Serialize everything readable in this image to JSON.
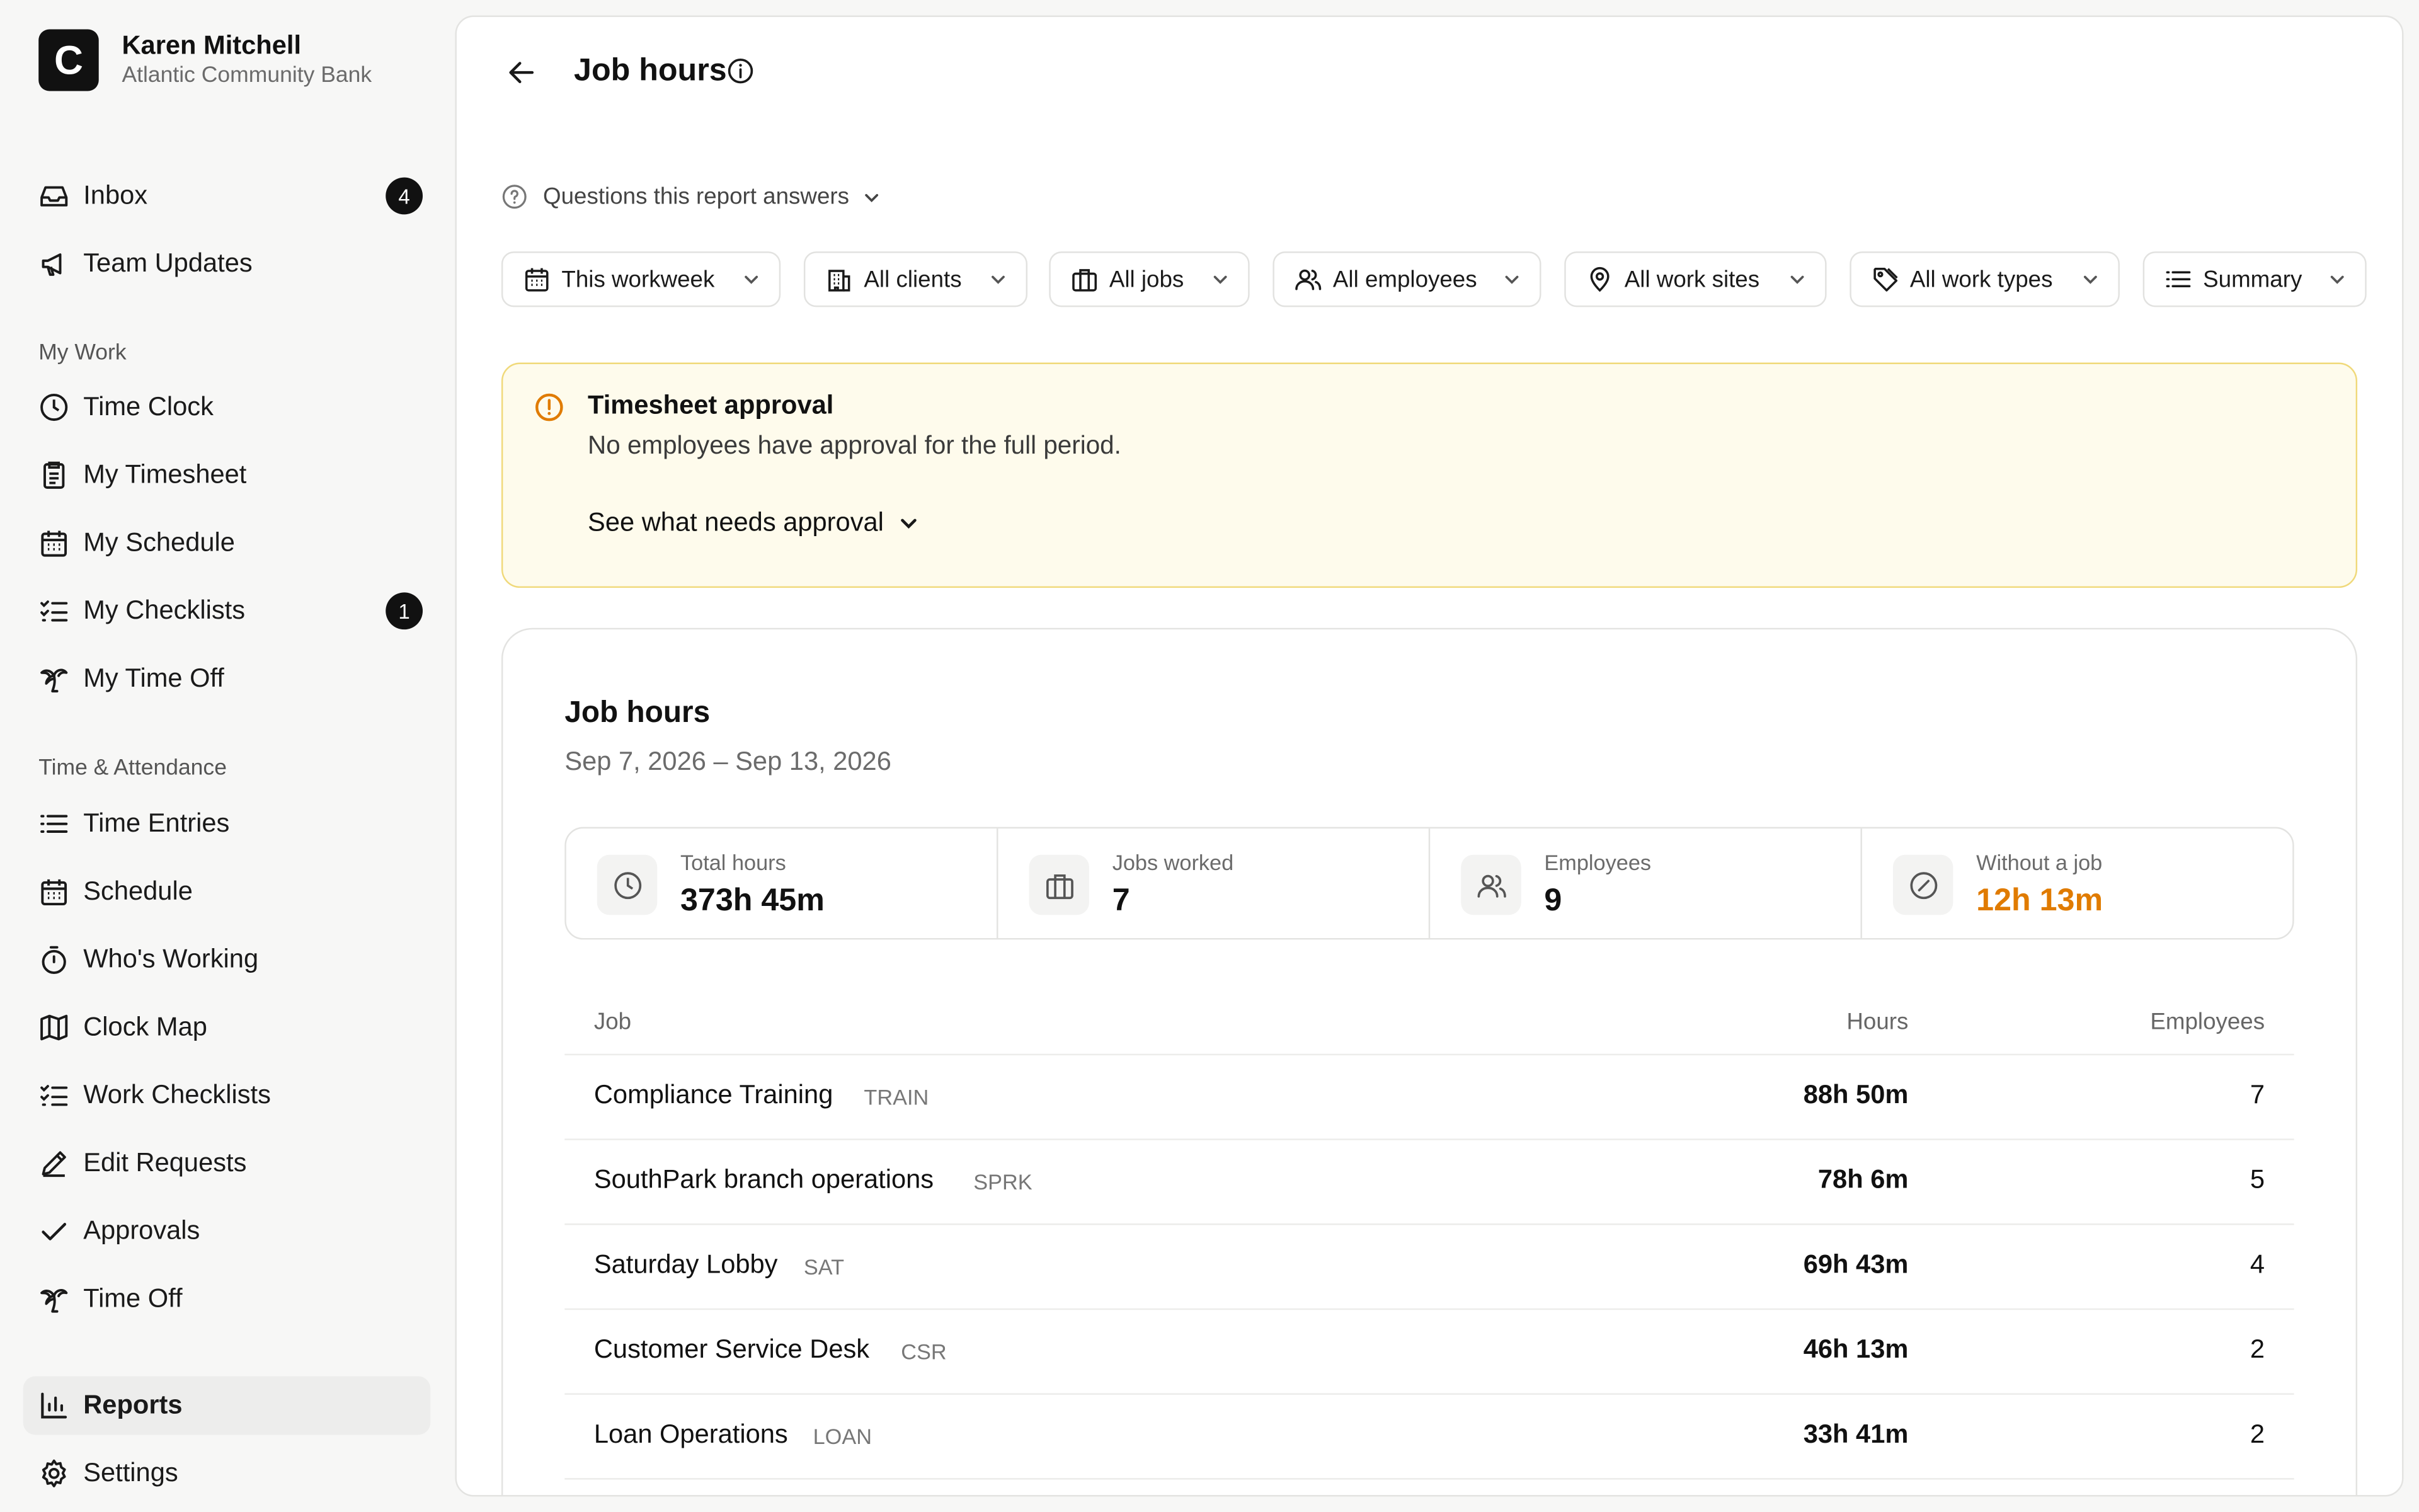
{
  "org": {
    "logo_letter": "C",
    "user_name": "Karen Mitchell",
    "company": "Atlantic Community Bank"
  },
  "sidebar": {
    "top_items": [
      {
        "label": "Inbox",
        "icon": "inbox-icon",
        "badge": "4"
      },
      {
        "label": "Team Updates",
        "icon": "megaphone-icon"
      }
    ],
    "my_work_label": "My Work",
    "my_work": [
      {
        "label": "Time Clock",
        "icon": "clock-icon"
      },
      {
        "label": "My Timesheet",
        "icon": "clipboard-icon"
      },
      {
        "label": "My Schedule",
        "icon": "calendar-icon"
      },
      {
        "label": "My Checklists",
        "icon": "checklist-icon",
        "badge": "1"
      },
      {
        "label": "My Time Off",
        "icon": "palm-tree-icon"
      }
    ],
    "ta_label": "Time & Attendance",
    "time_attendance": [
      {
        "label": "Time Entries",
        "icon": "list-icon"
      },
      {
        "label": "Schedule",
        "icon": "calendar-icon"
      },
      {
        "label": "Who's Working",
        "icon": "stopwatch-icon"
      },
      {
        "label": "Clock Map",
        "icon": "map-icon"
      },
      {
        "label": "Work Checklists",
        "icon": "checklist-icon"
      },
      {
        "label": "Edit Requests",
        "icon": "pencil-icon"
      },
      {
        "label": "Approvals",
        "icon": "check-icon"
      },
      {
        "label": "Time Off",
        "icon": "palm-tree-icon"
      }
    ],
    "bottom_items": [
      {
        "label": "Reports",
        "icon": "bar-chart-icon",
        "active": true
      },
      {
        "label": "Settings",
        "icon": "gear-icon"
      }
    ]
  },
  "header": {
    "title": "Job hours"
  },
  "questions_label": "Questions this report answers",
  "filters": [
    {
      "label": "This workweek",
      "icon": "calendar-icon"
    },
    {
      "label": "All clients",
      "icon": "building-icon"
    },
    {
      "label": "All jobs",
      "icon": "briefcase-icon"
    },
    {
      "label": "All employees",
      "icon": "users-icon"
    },
    {
      "label": "All work sites",
      "icon": "map-pin-icon"
    },
    {
      "label": "All work types",
      "icon": "tag-icon"
    },
    {
      "label": "Summary",
      "icon": "list-icon"
    }
  ],
  "alert": {
    "title": "Timesheet approval",
    "text": "No employees have approval for the full period.",
    "link": "See what needs approval",
    "color": "#e07b00"
  },
  "report": {
    "title": "Job hours",
    "date_range": "Sep 7, 2026 – Sep 13, 2026",
    "stats": [
      {
        "label": "Total hours",
        "value": "373h 45m",
        "icon": "clock-icon"
      },
      {
        "label": "Jobs worked",
        "value": "7",
        "icon": "briefcase-icon"
      },
      {
        "label": "Employees",
        "value": "9",
        "icon": "users-icon"
      },
      {
        "label": "Without a job",
        "value": "12h 13m",
        "icon": "no-job-icon",
        "warning": true
      }
    ],
    "columns": {
      "job": "Job",
      "hours": "Hours",
      "employees": "Employees"
    },
    "rows": [
      {
        "name": "Compliance Training",
        "code": "TRAIN",
        "hours": "88h 50m",
        "employees": "7"
      },
      {
        "name": "SouthPark branch operations",
        "code": "SPRK",
        "hours": "78h 6m",
        "employees": "5"
      },
      {
        "name": "Saturday Lobby",
        "code": "SAT",
        "hours": "69h 43m",
        "employees": "4"
      },
      {
        "name": "Customer Service Desk",
        "code": "CSR",
        "hours": "46h 13m",
        "employees": "2"
      },
      {
        "name": "Loan Operations",
        "code": "LOAN",
        "hours": "33h 41m",
        "employees": "2"
      }
    ]
  },
  "colors": {
    "accent": "#111111",
    "warning": "#e07b00",
    "alert_bg": "#fefbec",
    "alert_border": "#f0d97a"
  }
}
